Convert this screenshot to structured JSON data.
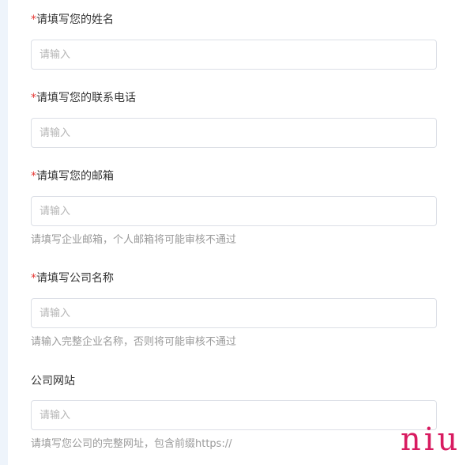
{
  "form": {
    "fields": [
      {
        "label": "请填写您的姓名",
        "required": "*",
        "placeholder": "请输入",
        "value": ""
      },
      {
        "label": "请填写您的联系电话",
        "required": "*",
        "placeholder": "请输入",
        "value": ""
      },
      {
        "label": "请填写您的邮箱",
        "required": "*",
        "placeholder": "请输入",
        "value": "",
        "hint": "请填写企业邮箱，个人邮箱将可能审核不通过"
      },
      {
        "label": "请填写公司名称",
        "required": "*",
        "placeholder": "请输入",
        "value": "",
        "hint": "请输入完整企业名称，否则将可能审核不通过"
      },
      {
        "label": "公司网站",
        "placeholder": "请输入",
        "value": "",
        "hint": "请填写您公司的完整网址，包含前缀https://"
      }
    ]
  },
  "watermark": {
    "text": "niu",
    "color": "#d81b60"
  },
  "colors": {
    "required": "#e53935",
    "label": "#333333",
    "hint": "#9a9a9a",
    "placeholder": "#b5b5b5",
    "input_border": "#dcdfe6"
  }
}
